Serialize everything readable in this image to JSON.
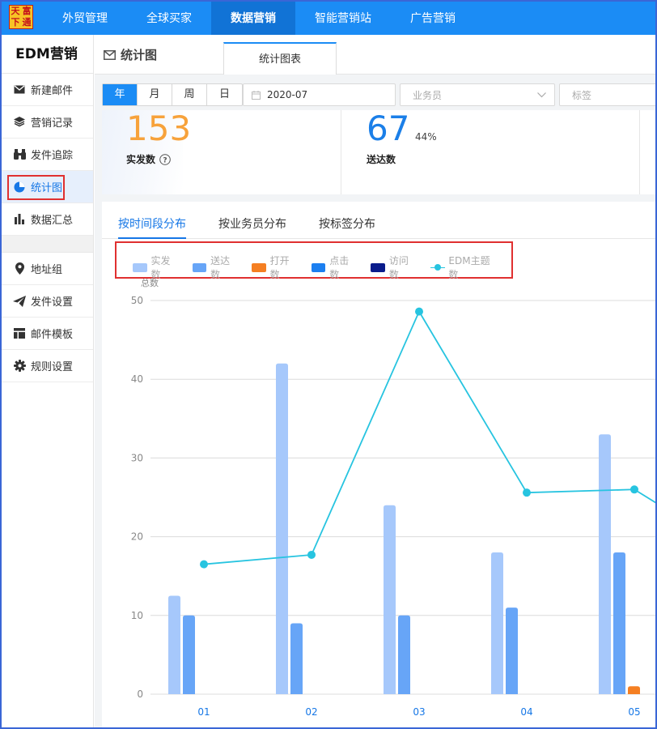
{
  "logo": {
    "chars": [
      "天",
      "富",
      "下",
      "通"
    ]
  },
  "nav": {
    "items": [
      "外贸管理",
      "全球买家",
      "数据营销",
      "智能营销站",
      "广告营销"
    ],
    "active_index": 2
  },
  "sidebar": {
    "title": "EDM营销",
    "items": [
      {
        "label": "新建邮件",
        "icon": "envelope-icon"
      },
      {
        "label": "营销记录",
        "icon": "layers-icon"
      },
      {
        "label": "发件追踪",
        "icon": "binoculars-icon"
      },
      {
        "label": "统计图",
        "icon": "pie-chart-icon"
      },
      {
        "label": "数据汇总",
        "icon": "bar-chart-icon"
      },
      {
        "label": "地址组",
        "icon": "map-pin-icon"
      },
      {
        "label": "发件设置",
        "icon": "paper-plane-icon"
      },
      {
        "label": "邮件模板",
        "icon": "template-icon"
      },
      {
        "label": "规则设置",
        "icon": "gear-icon"
      }
    ],
    "active_index": 3
  },
  "header": {
    "title": "统计图",
    "tab": "统计图表"
  },
  "filters": {
    "periods": [
      "年",
      "月",
      "周",
      "日"
    ],
    "active_period": 0,
    "date": "2020-07",
    "salesperson_placeholder": "业务员",
    "tag_placeholder": "标签"
  },
  "stats": {
    "sent": {
      "value": "153",
      "label": "实发数",
      "color": "#f7a23b"
    },
    "delivered": {
      "value": "67",
      "label": "送达数",
      "percent": "44%",
      "color": "#1b7fe8"
    }
  },
  "chart_tabs": [
    "按时间段分布",
    "按业务员分布",
    "按标签分布"
  ],
  "chart_tab_active": 0,
  "chart_data": {
    "type": "bar",
    "ylabel": "总数",
    "ylim": [
      0,
      50
    ],
    "yticks": [
      0,
      10,
      20,
      30,
      40,
      50
    ],
    "categories": [
      "01",
      "02",
      "03",
      "04",
      "05"
    ],
    "series": [
      {
        "name": "实发数",
        "kind": "bar",
        "color": "#a6c8fb",
        "values": [
          12.5,
          42,
          24,
          18,
          33
        ]
      },
      {
        "name": "送达数",
        "kind": "bar",
        "color": "#67a5f7",
        "values": [
          10,
          9,
          10,
          11,
          18
        ]
      },
      {
        "name": "打开数",
        "kind": "bar",
        "color": "#f57f22",
        "values": [
          0,
          0,
          0,
          0,
          1
        ]
      },
      {
        "name": "点击数",
        "kind": "bar",
        "color": "#1c7ff0",
        "values": [
          0,
          0,
          0,
          0,
          0
        ]
      },
      {
        "name": "访问数",
        "kind": "bar",
        "color": "#0a1c8c",
        "values": [
          0,
          0,
          0,
          0,
          0
        ]
      },
      {
        "name": "EDM主题数",
        "kind": "line",
        "color": "#27c4e0",
        "values": [
          16.5,
          17.7,
          48.6,
          25.6,
          26
        ]
      }
    ],
    "legend_position": "top-left",
    "grid": true
  }
}
